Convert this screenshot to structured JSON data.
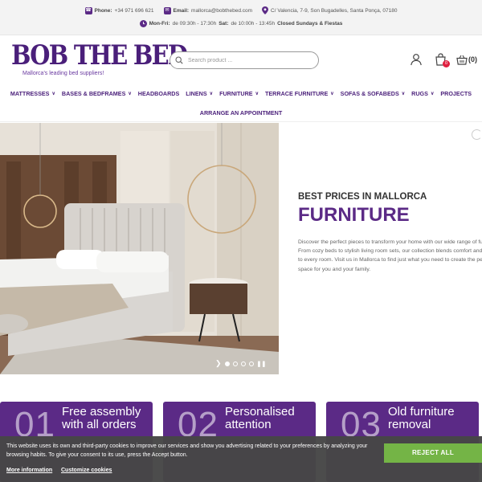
{
  "topbar": {
    "phone_label": "Phone:",
    "phone_value": "+34 971 696 621",
    "email_label": "Email:",
    "email_value": "mallorca@bobthebed.com",
    "address": "C/ Valencia, 7-9, Son Bugadelles, Santa Ponça, 07180",
    "hours_label1": "Mon-Fri:",
    "hours_value1": "de 09:30h - 17:30h",
    "hours_label2": "Sat:",
    "hours_value2": "de 10:00h - 13:45h",
    "hours_closed": "Closed Sundays & Fiestas",
    "icon_color": "#5b2a86"
  },
  "header": {
    "logo_text": "BOB THE BED",
    "tagline": "Mallorca's leading bed suppliers!",
    "search_placeholder": "Search product ...",
    "wishlist_count": "0",
    "cart_count": "(0)",
    "icons": [
      "user-icon",
      "shopping-bag-icon",
      "basket-icon",
      "search-icon"
    ],
    "brand_color": "#4a1f7a"
  },
  "nav": {
    "items": [
      {
        "label": "MATTRESSES",
        "dropdown": true
      },
      {
        "label": "BASES & BEDFRAMES",
        "dropdown": true
      },
      {
        "label": "HEADBOARDS",
        "dropdown": false
      },
      {
        "label": "LINENS",
        "dropdown": true
      },
      {
        "label": "FURNITURE",
        "dropdown": true
      },
      {
        "label": "TERRACE FURNITURE",
        "dropdown": true
      },
      {
        "label": "SOFAS & SOFABEDS",
        "dropdown": true
      },
      {
        "label": "RUGS",
        "dropdown": true
      },
      {
        "label": "PROJECTS",
        "dropdown": false
      }
    ],
    "appointment": "ARRANGE AN APPOINTMENT"
  },
  "hero": {
    "kicker": "BEST PRICES IN MALLORCA",
    "headline": "FURNITURE",
    "description": "Discover the perfect pieces to transform your home with our wide range of furniture. From cozy beds to stylish living room sets, our collection blends comfort and elegance to every room. Visit us in Mallorca to find just what you need to create the perfect space for you and your family.",
    "slides": 4,
    "active_slide": 1,
    "accent_color": "#5b2a86"
  },
  "features": [
    {
      "num": "01",
      "text": "Free assembly with all orders"
    },
    {
      "num": "02",
      "text": "Personalised attention"
    },
    {
      "num": "03",
      "text": "Old furniture removal"
    }
  ],
  "cookie": {
    "text": "This website uses its own and third-party cookies to improve our services and show you advertising related to your preferences by analyzing your browsing habits. To give your consent to its use, press the Accept button.",
    "reject_label": "REJECT ALL",
    "more_info": "More information",
    "customize": "Customize cookies",
    "button_color": "#74b446"
  }
}
